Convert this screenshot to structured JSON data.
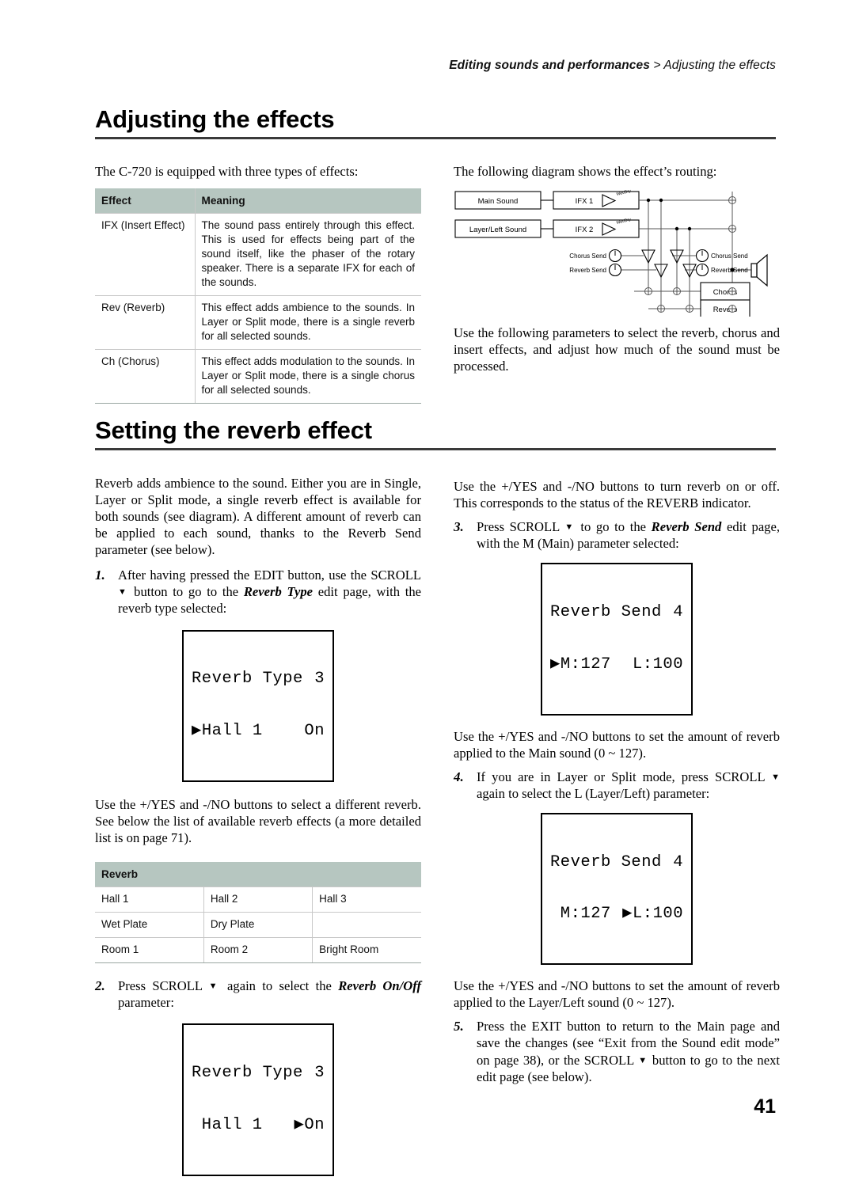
{
  "header": {
    "breadcrumb_bold": "Editing sounds and performances",
    "breadcrumb_sep": " > ",
    "breadcrumb_rest": "Adjusting the effects"
  },
  "sections": {
    "effects_title": "Adjusting the effects",
    "reverb_title": "Setting the reverb effect"
  },
  "left": {
    "intro": "The C-720 is equipped with three types of effects:",
    "effects_table": {
      "headers": [
        "Effect",
        "Meaning"
      ],
      "rows": [
        [
          "IFX (Insert Effect)",
          "The sound pass entirely through this effect. This is used for effects being part of the sound itself, like the phaser of the rotary speaker. There is a separate IFX for each of the sounds."
        ],
        [
          "Rev (Reverb)",
          "This effect adds ambience to the sounds. In Layer or Split mode, there is a single reverb for all selected sounds."
        ],
        [
          "Ch (Chorus)",
          "This effect adds modulation to the sounds. In Layer or Split mode, there is a single chorus for all selected sounds."
        ]
      ]
    },
    "reverb_intro": "Reverb adds ambience to the sound. Either you are in Single, Layer or Split mode, a single reverb effect is available for both sounds (see diagram). A different amount of reverb can be applied to each sound, thanks to the Reverb Send parameter (see below).",
    "step1": {
      "num": "1.",
      "part_a": "After having pressed the EDIT button, use the SCROLL ",
      "triangle": "▼",
      "part_b": " button to go to the ",
      "emph": "Reverb Type",
      "part_c": " edit page, with the reverb type selected:"
    },
    "lcd1": {
      "line1_left": "Reverb Type",
      "line1_right": "3",
      "line2_left": "▶Hall 1",
      "line2_right": "On"
    },
    "after_lcd1": "Use the +/YES and -/NO buttons to select a different reverb. See below the list of available reverb effects (a more detailed list is on page 71).",
    "reverb_table": {
      "header": "Reverb",
      "rows": [
        [
          "Hall 1",
          "Hall 2",
          "Hall 3"
        ],
        [
          "Wet Plate",
          "Dry Plate",
          ""
        ],
        [
          "Room 1",
          "Room 2",
          "Bright Room"
        ]
      ]
    },
    "step2": {
      "num": "2.",
      "part_a": "Press SCROLL ",
      "triangle": "▼",
      "part_b": " again to select the ",
      "emph": "Reverb On/Off",
      "part_c": " parameter:"
    },
    "lcd2": {
      "line1_left": "Reverb Type",
      "line1_right": "3",
      "line2_left": " Hall 1",
      "line2_right": "▶On"
    }
  },
  "right": {
    "diagram_intro": "The following diagram shows the effect’s routing:",
    "diagram": {
      "main_sound": "Main Sound",
      "layer_sound": "Layer/Left Sound",
      "ifx1": "IFX 1",
      "ifx2": "IFX 2",
      "wet_dry": "Wet/Dry",
      "chorus_send_left": "Chorus Send",
      "reverb_send_left": "Reverb Send",
      "chorus_send_right": "Chorus Send",
      "reverb_send_right": "Reverb Send",
      "chorus": "Chorus",
      "reverb": "Reverb"
    },
    "params_note": "Use the following parameters to select the reverb, chorus and insert effects, and adjust how much of the sound must be processed.",
    "onoff_note": "Use the +/YES and -/NO buttons to turn reverb on or off. This corresponds to the status of the REVERB indicator.",
    "step3": {
      "num": "3.",
      "part_a": "Press SCROLL ",
      "triangle": "▼",
      "part_b": " to go to the ",
      "emph": "Reverb Send",
      "part_c": " edit page, with the M (Main) parameter selected:"
    },
    "lcd3": {
      "line1_left": "Reverb Send",
      "line1_right": "4",
      "line2_left": "▶M:127",
      "line2_right": "L:100"
    },
    "after_lcd3": "Use the +/YES and -/NO buttons to set the amount of reverb applied to the Main sound (0 ~ 127).",
    "step4": {
      "num": "4.",
      "part_a": "If you are in Layer or Split mode, press SCROLL ",
      "triangle": "▼",
      "part_b": " again to select the L (Layer/Left) parameter:"
    },
    "lcd4": {
      "line1_left": "Reverb Send",
      "line1_right": "4",
      "line2_left": " M:127",
      "line2_right": "▶L:100"
    },
    "after_lcd4": "Use the +/YES and -/NO buttons to set the amount of reverb applied to the Layer/Left sound (0 ~ 127).",
    "step5": {
      "num": "5.",
      "part_a": "Press the EXIT button to return to the Main page and save the changes (see “Exit from the Sound edit mode” on page 38), or the SCROLL ",
      "triangle": "▼",
      "part_b": " button to go to the next edit page (see below)."
    }
  },
  "footer": {
    "page_number": "41"
  }
}
